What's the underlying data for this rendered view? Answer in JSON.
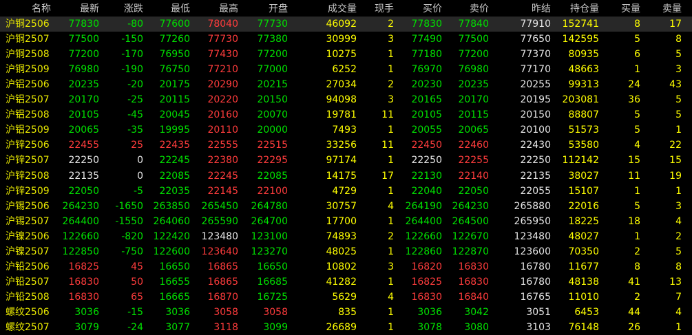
{
  "headers": [
    "名称",
    "最新",
    "涨跌",
    "最低",
    "最高",
    "开盘",
    "成交量",
    "现手",
    "买价",
    "卖价",
    "昨结",
    "持仓量",
    "买量",
    "卖量"
  ],
  "colors": {
    "up": "#ff3c3c",
    "down": "#00e000",
    "flat": "#e6e6e6",
    "yellow": "#ffff00",
    "header": "#c8c8c8",
    "background": "#000000",
    "selected_row": "#282828"
  },
  "selected_index": 0,
  "rows": [
    [
      "沪铜2506",
      "77830",
      "-80",
      "77600",
      "78040",
      "77730",
      "46092",
      "2",
      "77830",
      "77840",
      "77910",
      "152741",
      "8",
      "17"
    ],
    [
      "沪铜2507",
      "77500",
      "-150",
      "77260",
      "77730",
      "77380",
      "30999",
      "3",
      "77490",
      "77500",
      "77650",
      "142595",
      "5",
      "8"
    ],
    [
      "沪铜2508",
      "77200",
      "-170",
      "76950",
      "77430",
      "77200",
      "10275",
      "1",
      "77180",
      "77200",
      "77370",
      "80935",
      "6",
      "5"
    ],
    [
      "沪铜2509",
      "76980",
      "-190",
      "76750",
      "77210",
      "77000",
      "6252",
      "1",
      "76970",
      "76980",
      "77170",
      "48663",
      "1",
      "3"
    ],
    [
      "沪铝2506",
      "20235",
      "-20",
      "20175",
      "20290",
      "20215",
      "27034",
      "2",
      "20230",
      "20235",
      "20255",
      "99313",
      "24",
      "43"
    ],
    [
      "沪铝2507",
      "20170",
      "-25",
      "20115",
      "20220",
      "20150",
      "94098",
      "3",
      "20165",
      "20170",
      "20195",
      "203081",
      "36",
      "5"
    ],
    [
      "沪铝2508",
      "20105",
      "-45",
      "20045",
      "20160",
      "20070",
      "19781",
      "11",
      "20105",
      "20115",
      "20150",
      "88807",
      "5",
      "5"
    ],
    [
      "沪铝2509",
      "20065",
      "-35",
      "19995",
      "20110",
      "20000",
      "7493",
      "1",
      "20055",
      "20065",
      "20100",
      "51573",
      "5",
      "1"
    ],
    [
      "沪锌2506",
      "22455",
      "25",
      "22435",
      "22555",
      "22515",
      "33256",
      "11",
      "22450",
      "22460",
      "22430",
      "53580",
      "4",
      "22"
    ],
    [
      "沪锌2507",
      "22250",
      "0",
      "22245",
      "22380",
      "22295",
      "97174",
      "1",
      "22250",
      "22255",
      "22250",
      "112142",
      "15",
      "15"
    ],
    [
      "沪锌2508",
      "22135",
      "0",
      "22085",
      "22245",
      "22085",
      "14175",
      "17",
      "22130",
      "22140",
      "22135",
      "38027",
      "11",
      "19"
    ],
    [
      "沪锌2509",
      "22050",
      "-5",
      "22035",
      "22145",
      "22100",
      "4729",
      "1",
      "22040",
      "22050",
      "22055",
      "15107",
      "1",
      "1"
    ],
    [
      "沪锡2506",
      "264230",
      "-1650",
      "263850",
      "265450",
      "264780",
      "30757",
      "4",
      "264190",
      "264230",
      "265880",
      "22016",
      "5",
      "3"
    ],
    [
      "沪锡2507",
      "264400",
      "-1550",
      "264060",
      "265590",
      "264700",
      "17700",
      "1",
      "264400",
      "264500",
      "265950",
      "18225",
      "18",
      "4"
    ],
    [
      "沪镍2506",
      "122660",
      "-820",
      "122420",
      "123480",
      "123100",
      "74893",
      "2",
      "122660",
      "122670",
      "123480",
      "48027",
      "1",
      "2"
    ],
    [
      "沪镍2507",
      "122850",
      "-750",
      "122600",
      "123640",
      "123270",
      "48025",
      "1",
      "122860",
      "122870",
      "123600",
      "70350",
      "2",
      "5"
    ],
    [
      "沪铅2506",
      "16825",
      "45",
      "16650",
      "16865",
      "16650",
      "10802",
      "3",
      "16820",
      "16830",
      "16780",
      "11677",
      "8",
      "8"
    ],
    [
      "沪铅2507",
      "16830",
      "50",
      "16655",
      "16865",
      "16685",
      "41282",
      "1",
      "16825",
      "16830",
      "16780",
      "48138",
      "41",
      "13"
    ],
    [
      "沪铅2508",
      "16830",
      "65",
      "16665",
      "16870",
      "16725",
      "5629",
      "4",
      "16830",
      "16840",
      "16765",
      "11010",
      "2",
      "7"
    ],
    [
      "螺纹2506",
      "3036",
      "-15",
      "3036",
      "3058",
      "3058",
      "835",
      "1",
      "3036",
      "3042",
      "3051",
      "6453",
      "44",
      "4"
    ],
    [
      "螺纹2507",
      "3079",
      "-24",
      "3077",
      "3118",
      "3099",
      "26689",
      "1",
      "3078",
      "3080",
      "3103",
      "76148",
      "26",
      "1"
    ]
  ]
}
